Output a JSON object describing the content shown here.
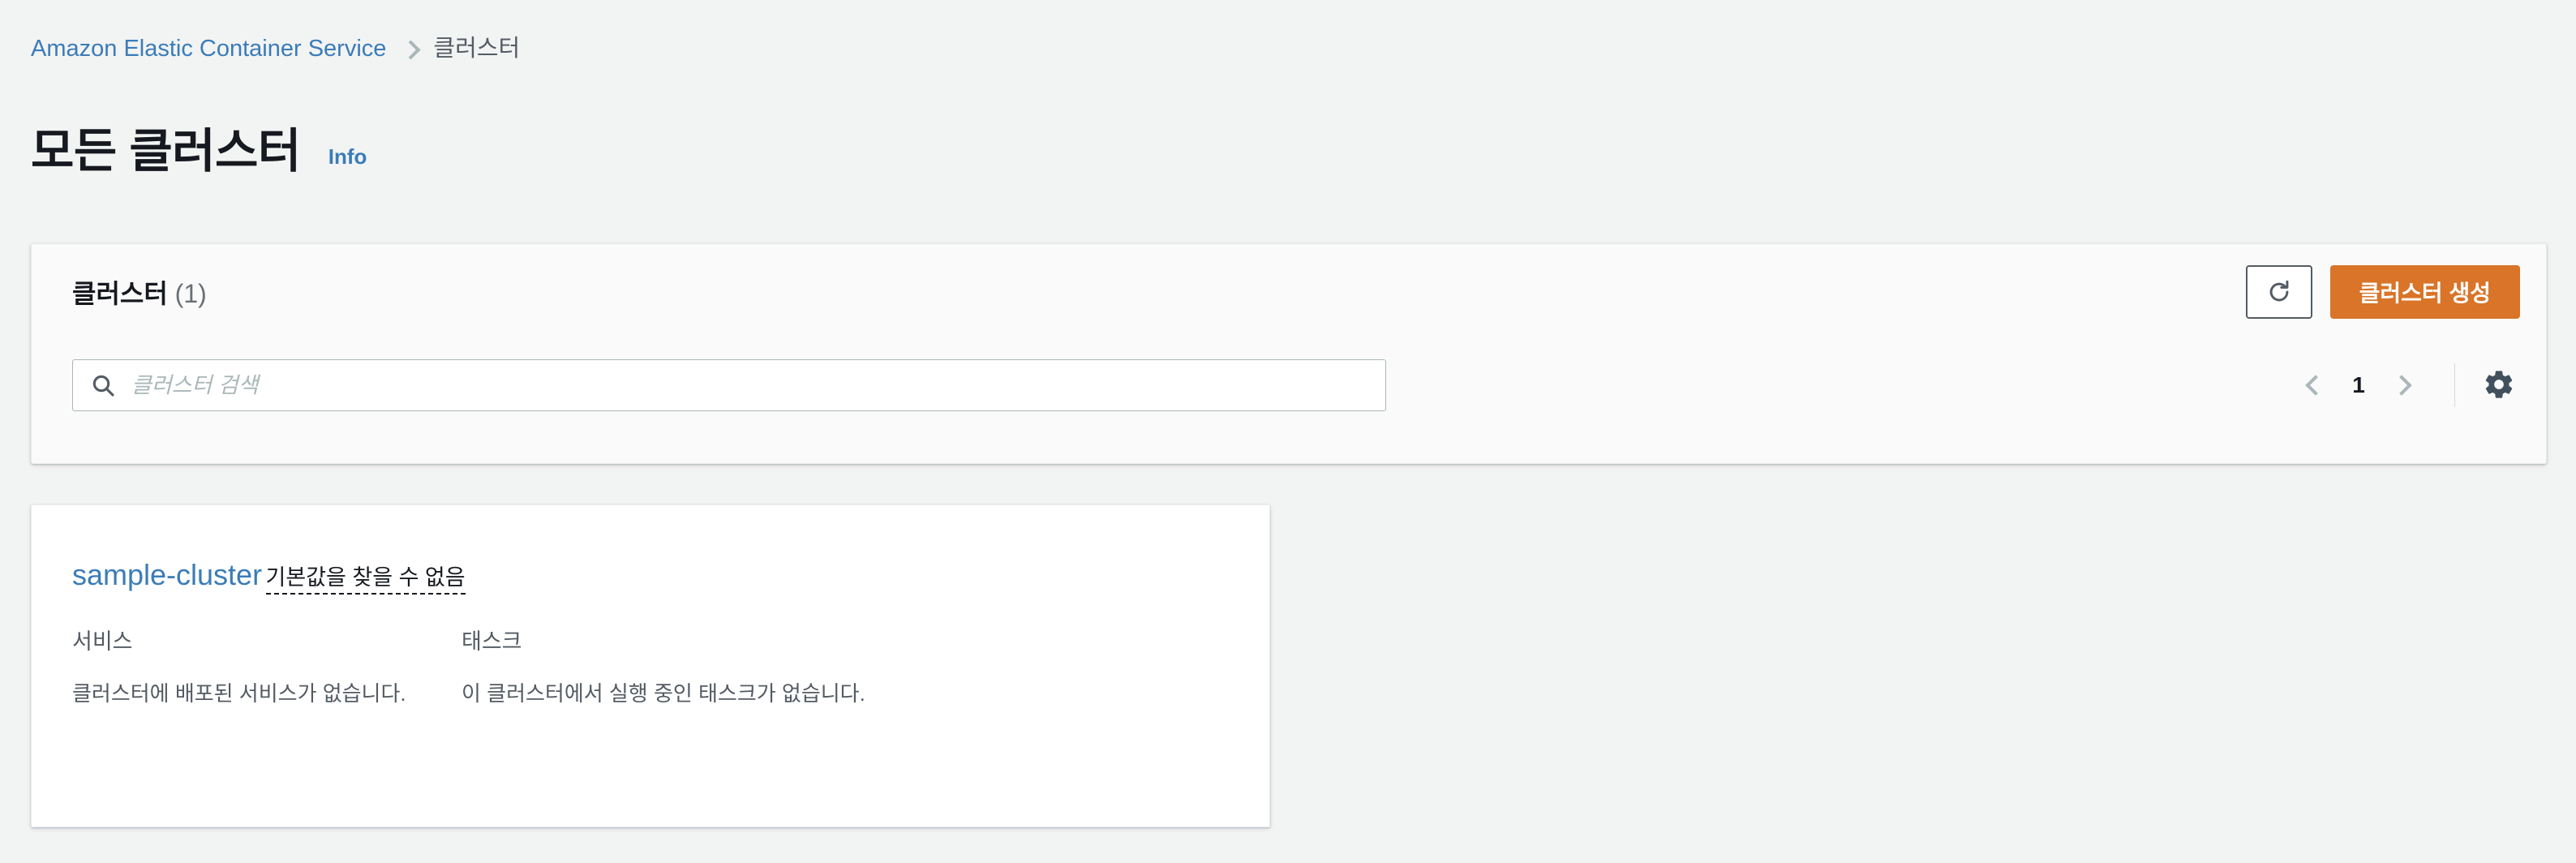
{
  "breadcrumb": {
    "service_link": "Amazon Elastic Container Service",
    "separator_icon": "chevron-right-icon",
    "current": "클러스터"
  },
  "page": {
    "title": "모든 클러스터",
    "info_label": "Info"
  },
  "panel": {
    "title": "클러스터",
    "count": "(1)",
    "refresh_icon": "refresh-icon",
    "create_button": "클러스터 생성",
    "search": {
      "placeholder": "클러스터 검색",
      "value": "",
      "icon": "search-icon"
    },
    "pagination": {
      "prev_icon": "chevron-left-icon",
      "current_page": "1",
      "next_icon": "chevron-right-icon",
      "settings_icon": "gear-icon"
    }
  },
  "clusters": [
    {
      "name": "sample-cluster",
      "status_note": "기본값을 찾을 수 없음",
      "columns": [
        {
          "label": "서비스",
          "value": "클러스터에 배포된 서비스가 없습니다."
        },
        {
          "label": "태스크",
          "value": "이 클러스터에서 실행 중인 태스크가 없습니다."
        }
      ]
    }
  ],
  "colors": {
    "page_background": "#f2f3f3",
    "panel_background": "#fafafa",
    "card_background": "#ffffff",
    "link_blue": "#3b7cb8",
    "primary_orange": "#d97428",
    "text_dark": "#16191f",
    "text_muted": "#545b64",
    "border": "#aab7b8"
  }
}
